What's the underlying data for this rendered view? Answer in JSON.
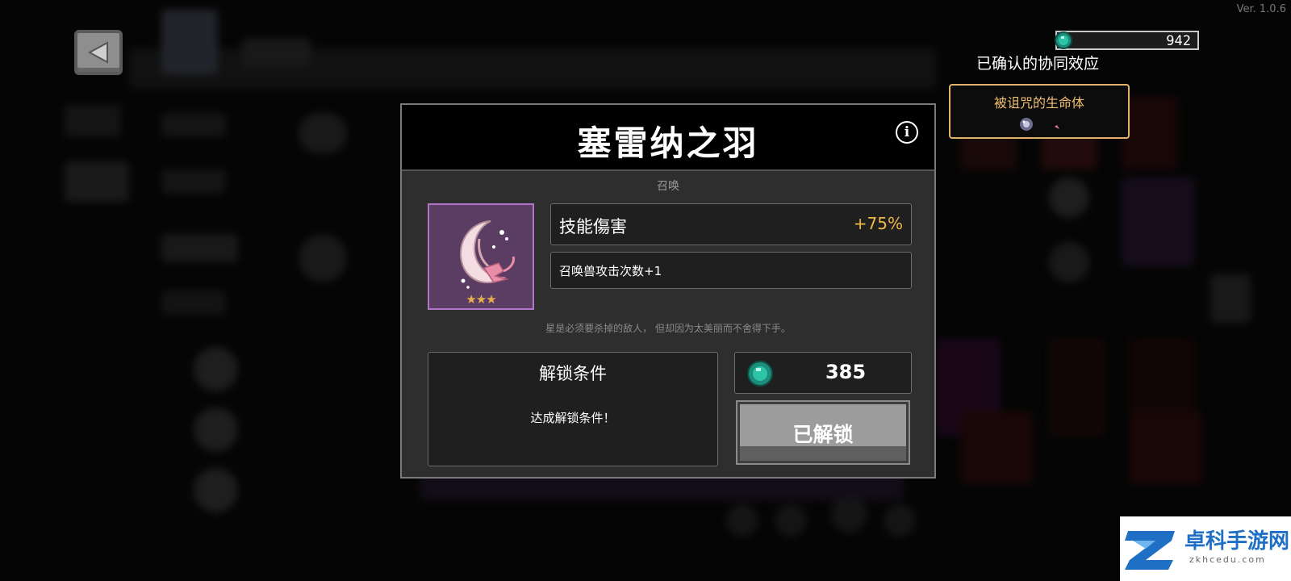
{
  "version": "Ver. 1.0.6",
  "currency": {
    "amount": "942",
    "icon": "gem-icon",
    "color": "#2ec4a6"
  },
  "synergy": {
    "title": "已确认的协同效应",
    "name": "被诅咒的生命体",
    "icons": [
      "orb-icon",
      "moon-feather-icon"
    ]
  },
  "modal": {
    "title": "塞雷纳之羽",
    "category": "召唤",
    "item": {
      "icon": "moon-feather-icon",
      "rarity_stars": "★★★",
      "box_color": "#5b3d63"
    },
    "stat_main": {
      "label": "技能傷害",
      "value": "+75%",
      "value_color": "#f0b845"
    },
    "stat_sub": {
      "label": "召唤兽攻击次数+1"
    },
    "flavor": "星是必须要杀掉的敌人， 但却因为太美丽而不舍得下手。",
    "unlock": {
      "title": "解锁条件",
      "description": "达成解锁条件！"
    },
    "cost": {
      "value": "385"
    },
    "unlocked_button": "已解锁"
  },
  "watermark": {
    "text": "卓科手游网",
    "domain": "zkhcedu.com"
  }
}
